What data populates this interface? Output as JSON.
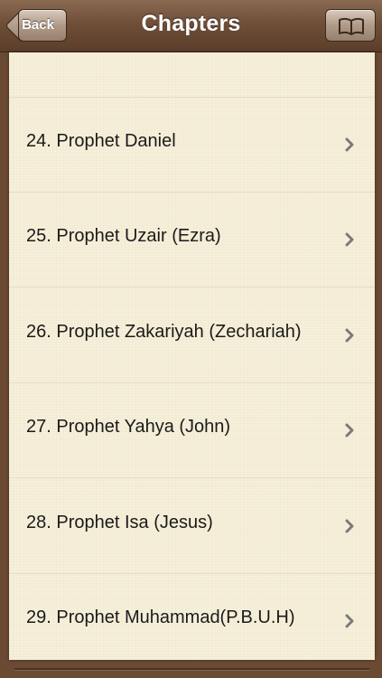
{
  "navbar": {
    "title": "Chapters",
    "back_label": "Back",
    "right_icon": "book-icon"
  },
  "chapters": [
    {
      "label": "24. Prophet Daniel"
    },
    {
      "label": "25. Prophet Uzair (Ezra)"
    },
    {
      "label": "26. Prophet Zakariyah (Zechariah)"
    },
    {
      "label": "27. Prophet Yahya (John)"
    },
    {
      "label": "28. Prophet Isa (Jesus)"
    },
    {
      "label": "29. Prophet Muhammad(P.B.U.H)"
    }
  ],
  "colors": {
    "navbar": "#6f4f38",
    "paper": "#f6efd9",
    "text": "#1a1a1a",
    "chevron": "#7a7a7a"
  }
}
